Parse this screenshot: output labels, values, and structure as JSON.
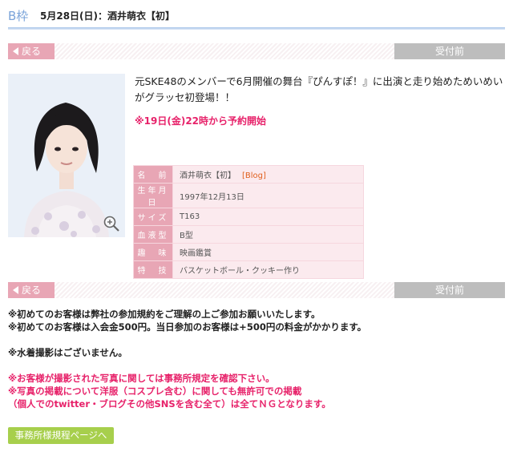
{
  "header": {
    "frame": "B枠",
    "title": "5月28日(日)：酒井萌衣【初】"
  },
  "nav": {
    "back_label": "戻る",
    "status_label": "受付前"
  },
  "event": {
    "headline": "元SKE48のメンバーで6月開催の舞台『ぴんすぽ！』に出演と走り始めためいめいがグラッセ初登場！！",
    "reservation": "※19日(金)22時から予約開始"
  },
  "profile": {
    "rows": [
      {
        "label": "名　前",
        "value": "酒井萌衣【初】",
        "link": "[Blog]"
      },
      {
        "label": "生年月日",
        "value": "1997年12月13日"
      },
      {
        "label": "サイズ",
        "value": "T163"
      },
      {
        "label": "血液型",
        "value": "B型"
      },
      {
        "label": "趣　味",
        "value": "映画鑑賞"
      },
      {
        "label": "特　技",
        "value": "バスケットボール・クッキー作り"
      }
    ]
  },
  "notes": {
    "line1": "※初めてのお客様は弊社の参加規約をご理解の上ご参加お願いいたします。",
    "line2": "※初めてのお客様は入会金500円。当日参加のお客様は+500円の料金がかかります。",
    "line3": "※水着撮影はございません。",
    "line4": "※お客様が撮影された写真に関しては事務所規定を確認下さい。",
    "line5": "※写真の掲載について洋服（コスプレ含む）に関しても無許可での掲載",
    "line6": "（個人でのtwitter・ブログその他SNSを含む全て）は全てＮＧとなります。"
  },
  "rules_button": {
    "label": "事務所様規程ページへ"
  },
  "colors": {
    "accent_pink": "#e8a6b5",
    "alert_pink": "#e7226a",
    "header_blue": "#7aa3d9",
    "button_green": "#a7cf4c"
  },
  "icons": {
    "back": "left-arrow-icon",
    "zoom": "zoom-in-icon"
  }
}
